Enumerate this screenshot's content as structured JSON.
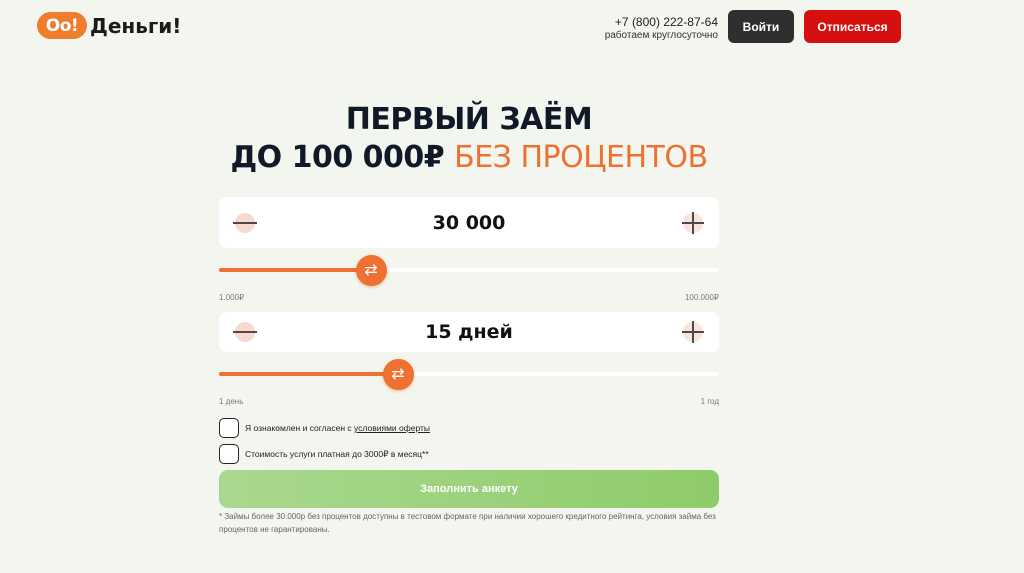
{
  "header": {
    "logo_badge": "Oo!",
    "logo_text": "Деньги!",
    "phone": "+7 (800) 222-87-64",
    "hours": "работаем круглосуточно",
    "login_label": "Войти",
    "unsubscribe_label": "Отписаться"
  },
  "hero": {
    "title_line1": "ПЕРВЫЙ ЗАЁМ",
    "title_line2_prefix": "ДО 100 000₽ ",
    "title_line2_accent": "БЕЗ ПРОЦЕНТОВ"
  },
  "amount": {
    "value": "30 000",
    "min_label": "1.000₽",
    "max_label": "100.000₽",
    "slider_fraction": 0.304
  },
  "term": {
    "value": "15 дней",
    "min_label": "1 день",
    "max_label": "1 год",
    "slider_fraction": 0.358
  },
  "agreements": {
    "offer_text": "Я ознакомлен и согласен с ",
    "offer_link": "условиями оферты",
    "fee_text": "Стоимость услуги платная до 3000₽ в месяц**"
  },
  "submit_label": "Заполнить анкету",
  "disclaimer": "* Займы более 30.000р без процентов доступны в тестовом формате при наличии хорошего кредитного рейтинга, условия займа без процентов не гарантированы.",
  "icons": {
    "minus": "minus-icon",
    "plus": "plus-icon",
    "slider_thumb": "swap-arrows-icon"
  },
  "colors": {
    "accent": "#ee7132",
    "unsubscribe": "#d60f0f",
    "submit": "#97d073",
    "background": "#f2f6ee"
  }
}
